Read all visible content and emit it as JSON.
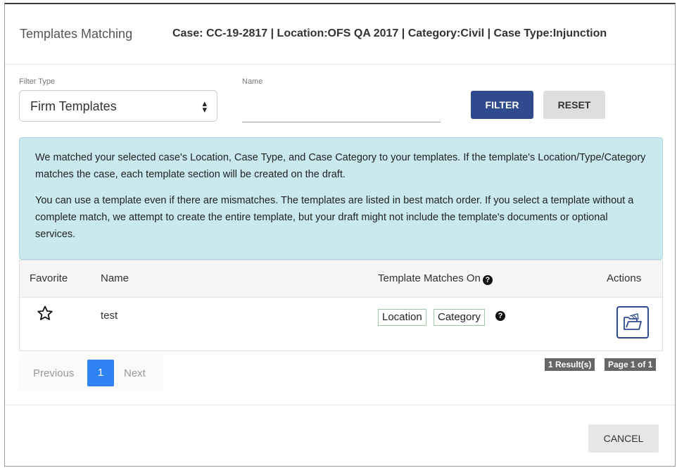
{
  "header": {
    "title": "Templates Matching",
    "case_info": "Case: CC-19-2817 | Location:OFS QA 2017 | Category:Civil | Case Type:Injunction"
  },
  "filters": {
    "filter_type_label": "Filter Type",
    "filter_type_value": "Firm Templates",
    "name_label": "Name",
    "name_value": "",
    "filter_button": "FILTER",
    "reset_button": "RESET"
  },
  "info": {
    "paragraph1": "We matched your selected case's Location, Case Type, and Case Category to your templates. If the template's Location/Type/Category matches the case, each template section will be created on the draft.",
    "paragraph2": "You can use a template even if there are mismatches. The templates are listed in best match order. If you select a template without a complete match, we attempt to create the entire template, but your draft might not include the template's documents or optional services."
  },
  "table": {
    "columns": {
      "favorite": "Favorite",
      "name": "Name",
      "matches": "Template Matches On",
      "actions": "Actions"
    },
    "rows": [
      {
        "name": "test",
        "matches": [
          "Location",
          "Category"
        ],
        "favorite": false
      }
    ]
  },
  "results": {
    "count": "1 Result(s)",
    "page": "Page 1 of 1"
  },
  "pager": {
    "prev": "Previous",
    "current": "1",
    "next": "Next"
  },
  "footer": {
    "cancel_button": "CANCEL"
  },
  "colors": {
    "primary": "#2f4a8f",
    "info_bg": "#c9e9ef",
    "page_active": "#2f83f2"
  }
}
